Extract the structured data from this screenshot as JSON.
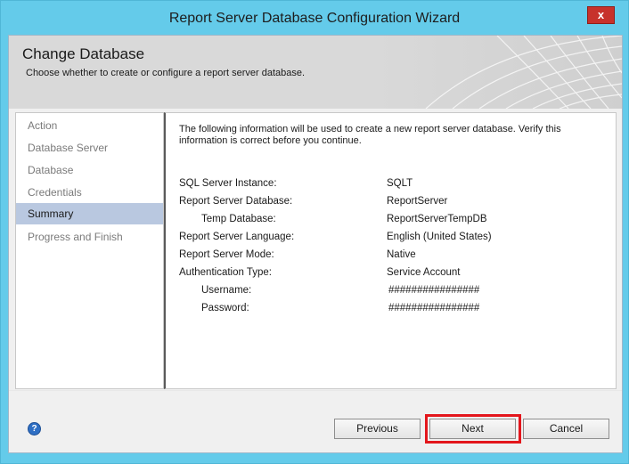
{
  "window": {
    "title": "Report Server Database Configuration Wizard",
    "close_glyph": "x"
  },
  "banner": {
    "title": "Change Database",
    "subtitle": "Choose whether to create or configure a report server database."
  },
  "nav": {
    "items": [
      {
        "label": "Action",
        "selected": false
      },
      {
        "label": "Database Server",
        "selected": false
      },
      {
        "label": "Database",
        "selected": false
      },
      {
        "label": "Credentials",
        "selected": false
      },
      {
        "label": "Summary",
        "selected": true
      },
      {
        "label": "Progress and Finish",
        "selected": false
      }
    ]
  },
  "summary": {
    "intro": "The following information will be used to create a new report server database. Verify this information is correct before you continue.",
    "rows": [
      {
        "label": "SQL Server Instance:",
        "value": "SQLT"
      },
      {
        "label": "Report Server Database:",
        "value": "ReportServer"
      },
      {
        "label": "Temp Database:",
        "value": "ReportServerTempDB"
      },
      {
        "label": "Report Server Language:",
        "value": "English (United States)"
      },
      {
        "label": "Report Server Mode:",
        "value": "Native"
      },
      {
        "label": "Authentication Type:",
        "value": "Service Account"
      },
      {
        "label": "Username:",
        "value": "################"
      },
      {
        "label": "Password:",
        "value": "################"
      }
    ]
  },
  "footer": {
    "help_glyph": "?",
    "previous_label": "Previous",
    "next_label": "Next",
    "cancel_label": "Cancel"
  },
  "colors": {
    "title_bar": "#64cbea",
    "selected_nav": "#b9c8e0",
    "highlight": "#e3161c",
    "close_button": "#c7322b"
  }
}
